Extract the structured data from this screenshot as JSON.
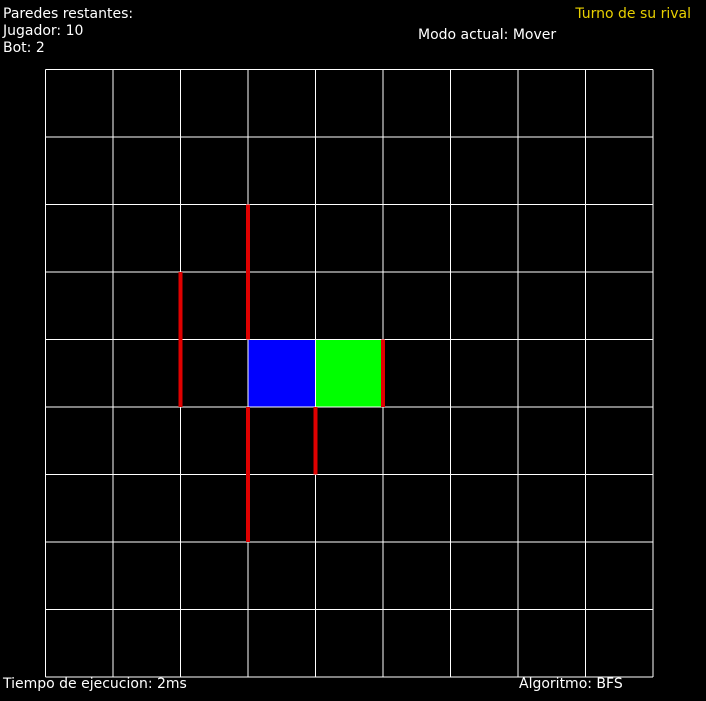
{
  "status": {
    "walls_title": "Paredes restantes:",
    "walls_player": "Jugador: 10",
    "walls_bot": "Bot: 2",
    "turn": "Turno de su rival",
    "mode": "Modo actual: Mover",
    "execution_time": "Tiempo de ejecucion: 2ms",
    "algorithm": "Algoritmo: BFS"
  },
  "board": {
    "rows": 9,
    "cols": 9,
    "grid_color": "#ffffff",
    "wall_color": "#e00000",
    "pieces": [
      {
        "name": "player-piece",
        "row": 4,
        "col": 3,
        "color": "#0000ff"
      },
      {
        "name": "bot-piece",
        "row": 4,
        "col": 4,
        "color": "#00ff00"
      }
    ],
    "walls": [
      {
        "orientation": "vertical",
        "line": 3,
        "from_row": 2,
        "to_row": 4
      },
      {
        "orientation": "vertical",
        "line": 2,
        "from_row": 3,
        "to_row": 5
      },
      {
        "orientation": "vertical",
        "line": 3,
        "from_row": 5,
        "to_row": 7
      },
      {
        "orientation": "vertical",
        "line": 4,
        "from_row": 5,
        "to_row": 6
      },
      {
        "orientation": "vertical",
        "line": 5,
        "from_row": 4,
        "to_row": 5
      }
    ]
  }
}
